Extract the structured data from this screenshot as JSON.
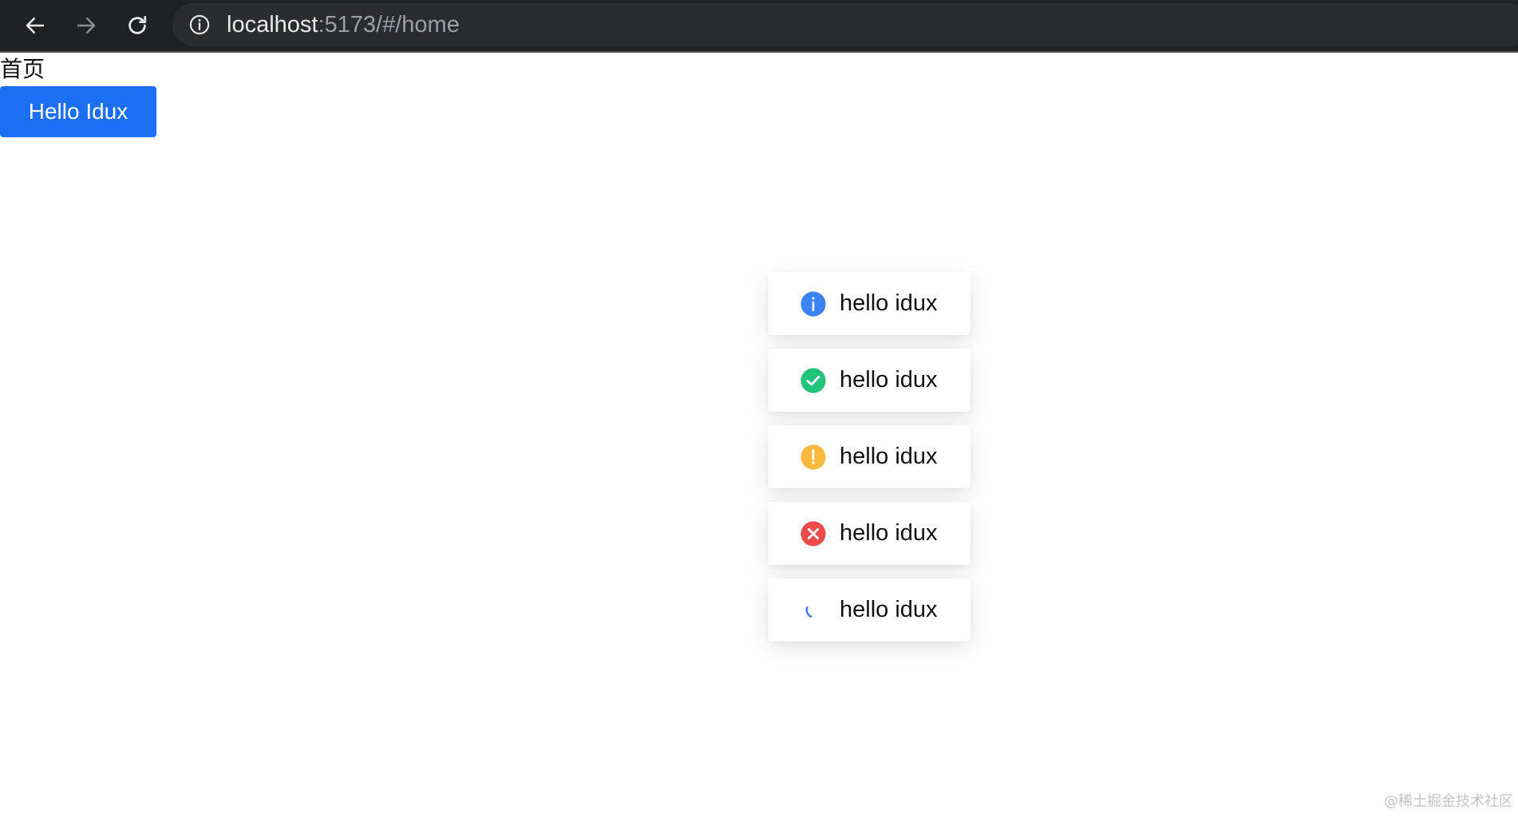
{
  "browser": {
    "url_host": "localhost",
    "url_rest": ":5173/#/home"
  },
  "page": {
    "title": "首页",
    "button_label": "Hello Idux"
  },
  "messages": [
    {
      "type": "info",
      "text": "hello idux",
      "color": "#3b82f6"
    },
    {
      "type": "success",
      "text": "hello idux",
      "color": "#22c37a"
    },
    {
      "type": "warning",
      "text": "hello idux",
      "color": "#f8b93c"
    },
    {
      "type": "error",
      "text": "hello idux",
      "color": "#f04b4b"
    },
    {
      "type": "loading",
      "text": "hello idux",
      "color": "#3b82f6"
    }
  ],
  "watermark": "@稀土掘金技术社区"
}
